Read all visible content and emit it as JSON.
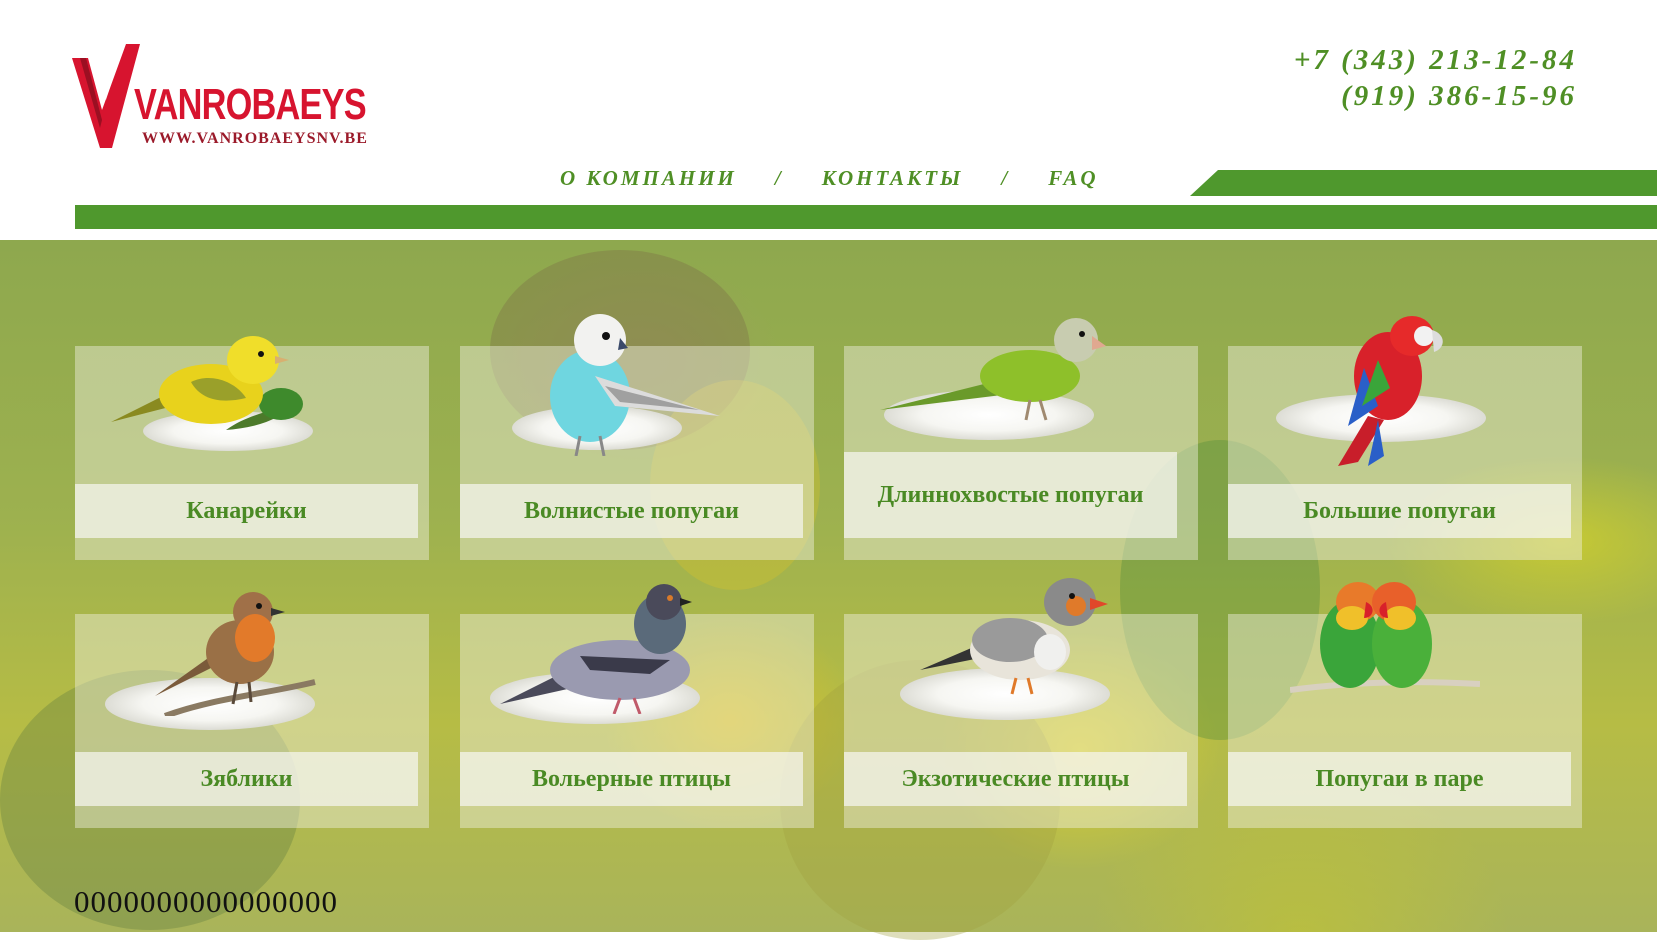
{
  "header": {
    "logo": {
      "name": "VANROBAEYS",
      "url": "WWW.VANROBAEYSNV.BE",
      "brand_color": "#d7142f"
    },
    "phones": [
      "+7 (343) 213-12-84",
      "(919) 386-15-96"
    ],
    "accent_color": "#4f8f25"
  },
  "nav": {
    "items": [
      {
        "label": "О КОМПАНИИ"
      },
      {
        "label": "КОНТАКТЫ"
      },
      {
        "label": "FAQ"
      }
    ],
    "separator": "/"
  },
  "categories": [
    {
      "label": "Канарейки",
      "icon": "canary-icon"
    },
    {
      "label": "Волнистые попугаи",
      "icon": "budgie-icon"
    },
    {
      "label": "Длиннохвостые попугаи",
      "icon": "monk-parakeet-icon"
    },
    {
      "label": "Большие попугаи",
      "icon": "macaw-icon"
    },
    {
      "label": "Зяблики",
      "icon": "robin-icon"
    },
    {
      "label": "Вольерные птицы",
      "icon": "pigeon-icon"
    },
    {
      "label": "Экзотические птицы",
      "icon": "zebra-finch-icon"
    },
    {
      "label": "Попугаи в паре",
      "icon": "lovebirds-icon"
    }
  ],
  "footer": {
    "counter": "0000000000000000"
  }
}
